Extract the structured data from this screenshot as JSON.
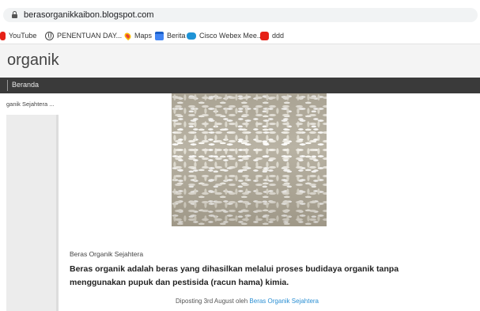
{
  "browser": {
    "url": "berasorganikkaibon.blogspot.com",
    "bookmarks": [
      {
        "label": "YouTube",
        "icon": "youtube-icon"
      },
      {
        "label": "PENENTUAN DAY...",
        "icon": "globe-icon"
      },
      {
        "label": "Maps",
        "icon": "maps-icon"
      },
      {
        "label": "Berita",
        "icon": "calendar-icon"
      },
      {
        "label": "Cisco Webex Mee...",
        "icon": "webex-icon"
      },
      {
        "label": "ddd",
        "icon": "youtube-icon"
      }
    ]
  },
  "blog": {
    "title": "organik",
    "nav": [
      {
        "label": "Beranda"
      }
    ]
  },
  "sidebar": {
    "label": "ganik Sejahtera ..."
  },
  "post": {
    "image_alt": "rice grains photo",
    "author_name": "Beras Organik Sejahtera",
    "body": "Beras organik adalah beras yang dihasilkan melalui proses budidaya organik tanpa menggunakan pupuk dan pestisida (racun hama) kimia.",
    "footer_prefix": "Diposting 3rd August oleh",
    "footer_author": "Beras Organik Sejahtera"
  },
  "colors": {
    "nav_background": "#3a3a3a",
    "link": "#2b8fd3",
    "title_bar": "#f4f4f4"
  }
}
